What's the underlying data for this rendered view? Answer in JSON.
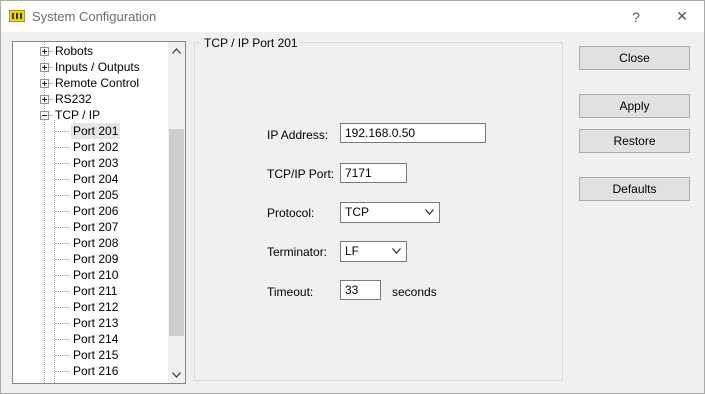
{
  "window": {
    "title": "System Configuration",
    "help_label": "?",
    "close_glyph": "✕"
  },
  "tree": {
    "items": [
      {
        "label": "Robots",
        "expander": "plus"
      },
      {
        "label": "Inputs / Outputs",
        "expander": "plus"
      },
      {
        "label": "Remote Control",
        "expander": "plus"
      },
      {
        "label": "RS232",
        "expander": "plus"
      },
      {
        "label": "TCP / IP",
        "expander": "minus"
      }
    ],
    "ports": [
      "Port 201",
      "Port 202",
      "Port 203",
      "Port 204",
      "Port 205",
      "Port 206",
      "Port 207",
      "Port 208",
      "Port 209",
      "Port 210",
      "Port 211",
      "Port 212",
      "Port 213",
      "Port 214",
      "Port 215",
      "Port 216"
    ],
    "selected": "Port 201"
  },
  "panel": {
    "title": "TCP / IP Port 201",
    "ip_label": "IP Address:",
    "ip_value": "192.168.0.50",
    "port_label": "TCP/IP Port:",
    "port_value": "7171",
    "protocol_label": "Protocol:",
    "protocol_value": "TCP",
    "terminator_label": "Terminator:",
    "terminator_value": "LF",
    "timeout_label": "Timeout:",
    "timeout_value": "33",
    "timeout_unit": "seconds"
  },
  "buttons": {
    "close": "Close",
    "apply": "Apply",
    "restore": "Restore",
    "defaults": "Defaults"
  }
}
